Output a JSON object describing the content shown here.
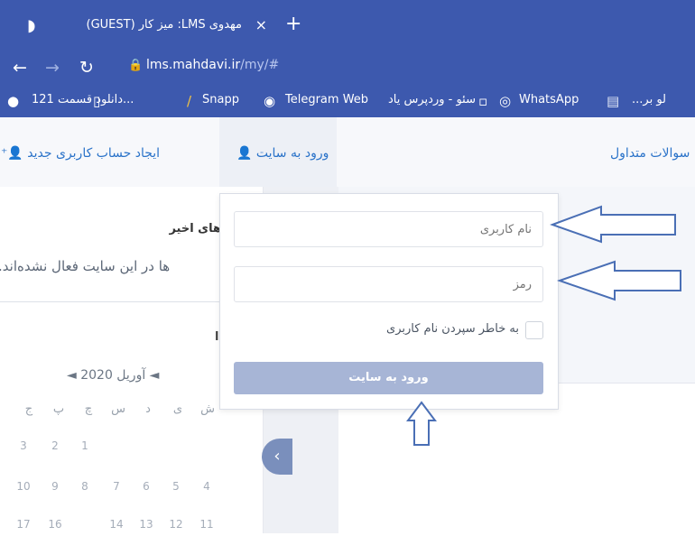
{
  "browser": {
    "tab_title": "مهدوی LMS: میز کار (GUEST)",
    "tab_close": "×",
    "new_tab": "+",
    "url_host": "lms.mahdavi.ir",
    "url_path": "/my/#",
    "bookmarks": [
      {
        "label": "...لو بر",
        "icon": "folder-icon"
      },
      {
        "label": "WhatsApp",
        "icon": "whatsapp-icon"
      },
      {
        "label": "سئو - وردپرس یاد",
        "icon": "page-icon"
      },
      {
        "label": "Telegram Web",
        "icon": "telegram-icon"
      },
      {
        "label": "Snapp",
        "icon": "snapp-icon"
      },
      {
        "label": "دانلود قسمت 121...",
        "icon": "bookmark-icon"
      }
    ]
  },
  "site_nav": {
    "faq": "سوالات متداول",
    "login": "ورود به سایت",
    "register": "ایجاد حساب کاربری جدید"
  },
  "sidebar": {
    "recent_heading": "های اخیر",
    "recent_text": "ها در این سایت فعال نشده‌اند.",
    "cal_title": "◄ آوریل 2020 ◄",
    "weekdays": [
      "ج",
      "پ",
      "چ",
      "س",
      "د",
      "ی",
      "ش"
    ],
    "week1": [
      "3",
      "2",
      "1",
      "",
      "",
      "",
      ""
    ],
    "week2": [
      "10",
      "9",
      "8",
      "7",
      "6",
      "5",
      "4"
    ],
    "week3": [
      "17",
      "16",
      "",
      "14",
      "13",
      "12",
      "11"
    ]
  },
  "login_form": {
    "username_placeholder": "نام کاربری",
    "password_placeholder": "رمز",
    "remember_label": "به خاطر سپردن نام کاربری",
    "submit_label": "ورود به سایت"
  },
  "colors": {
    "browser_chrome": "#3d59ae",
    "link": "#2b73c9",
    "submit_button": "#a7b5d6",
    "annotation_arrow": "#4a6fb5"
  }
}
